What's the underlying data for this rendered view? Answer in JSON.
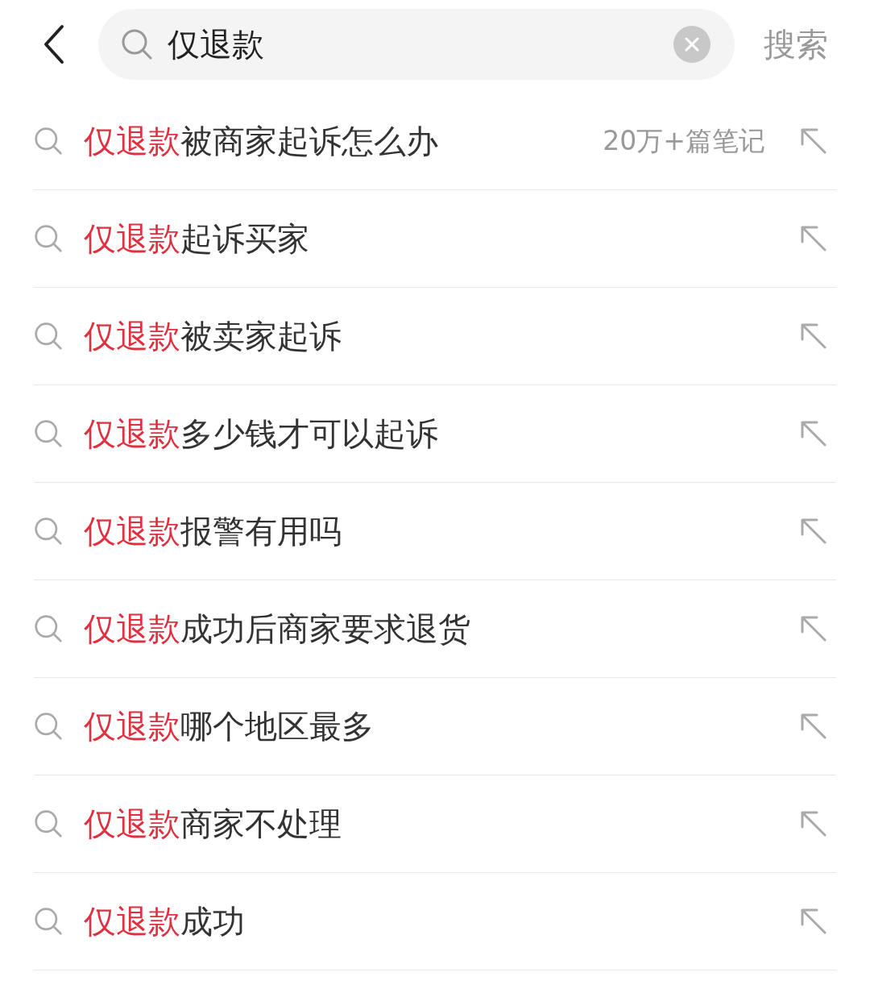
{
  "search": {
    "value": "仅退款",
    "action": "搜索"
  },
  "suggestions": [
    {
      "match": "仅退款",
      "rest": "被商家起诉怎么办",
      "count": "20万+篇笔记"
    },
    {
      "match": "仅退款",
      "rest": "起诉买家"
    },
    {
      "match": "仅退款",
      "rest": "被卖家起诉"
    },
    {
      "match": "仅退款",
      "rest": "多少钱才可以起诉"
    },
    {
      "match": "仅退款",
      "rest": "报警有用吗"
    },
    {
      "match": "仅退款",
      "rest": "成功后商家要求退货"
    },
    {
      "match": "仅退款",
      "rest": "哪个地区最多"
    },
    {
      "match": "仅退款",
      "rest": "商家不处理"
    },
    {
      "match": "仅退款",
      "rest": "成功"
    }
  ]
}
